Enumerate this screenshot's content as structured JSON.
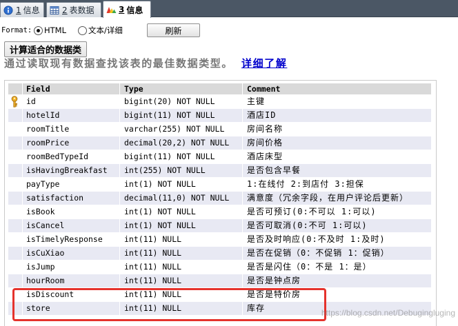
{
  "tabs": [
    {
      "number": "1",
      "label": "信息",
      "icon": "info-icon",
      "active": false
    },
    {
      "number": "2",
      "label": "表数据",
      "icon": "table-grid-icon",
      "active": false
    },
    {
      "number": "3",
      "label": "信息",
      "icon": "chart-icon",
      "active": true
    }
  ],
  "format": {
    "label": "Format:",
    "options": [
      {
        "label": "HTML",
        "checked": true
      },
      {
        "label": "文本/详细",
        "checked": false
      }
    ],
    "refresh_label": "刷新"
  },
  "analyze": {
    "button_label": "计算适合的数据类",
    "description": "通过读取现有数据查找该表的最佳数据类型。",
    "link_label": "详细了解"
  },
  "table": {
    "headers": {
      "field": "Field",
      "type": "Type",
      "comment": "Comment"
    },
    "rows": [
      {
        "icon": "primary-key-icon",
        "field": "id",
        "type": "bigint(20) NOT NULL",
        "comment": "主键"
      },
      {
        "field": "hotelId",
        "type": "bigint(11) NOT NULL",
        "comment": "酒店ID"
      },
      {
        "field": "roomTitle",
        "type": "varchar(255) NOT NULL",
        "comment": "房间名称"
      },
      {
        "field": "roomPrice",
        "type": "decimal(20,2) NOT NULL",
        "comment": "房间价格"
      },
      {
        "field": "roomBedTypeId",
        "type": "bigint(11) NOT NULL",
        "comment": "酒店床型"
      },
      {
        "field": "isHavingBreakfast",
        "type": "int(255) NOT NULL",
        "comment": "是否包含早餐"
      },
      {
        "field": "payType",
        "type": "int(1) NOT NULL",
        "comment": "1:在线付 2:到店付 3:担保"
      },
      {
        "field": "satisfaction",
        "type": "decimal(11,0) NOT NULL",
        "comment": "满意度（冗余字段，在用户评论后更新）"
      },
      {
        "field": "isBook",
        "type": "int(1) NOT NULL",
        "comment": "是否可预订(0:不可以 1:可以)"
      },
      {
        "field": "isCancel",
        "type": "int(1) NOT NULL",
        "comment": "是否可取消(0:不可 1:可以)"
      },
      {
        "field": "isTimelyResponse",
        "type": "int(11) NULL",
        "comment": "是否及时响应(0:不及时 1:及时)"
      },
      {
        "field": "isCuXiao",
        "type": "int(11) NULL",
        "comment": "是否在促销（0：不促销 1：促销）"
      },
      {
        "field": "isJump",
        "type": "int(11) NULL",
        "comment": "是否是闪住（0：不是 1：是）"
      },
      {
        "field": "hourRoom",
        "type": "int(11) NULL",
        "comment": "是否是钟点房"
      },
      {
        "field": "isDiscount",
        "type": "int(11) NULL",
        "comment": "是否是特价房"
      },
      {
        "field": "store",
        "type": "int(11) NULL",
        "comment": "库存"
      }
    ]
  },
  "watermark": "https://blog.csdn.net/Debugingluging",
  "colors": {
    "tab_bar": "#4b5765",
    "link": "#0000cc",
    "highlight_box": "#e5322c",
    "description_text": "#777777"
  }
}
